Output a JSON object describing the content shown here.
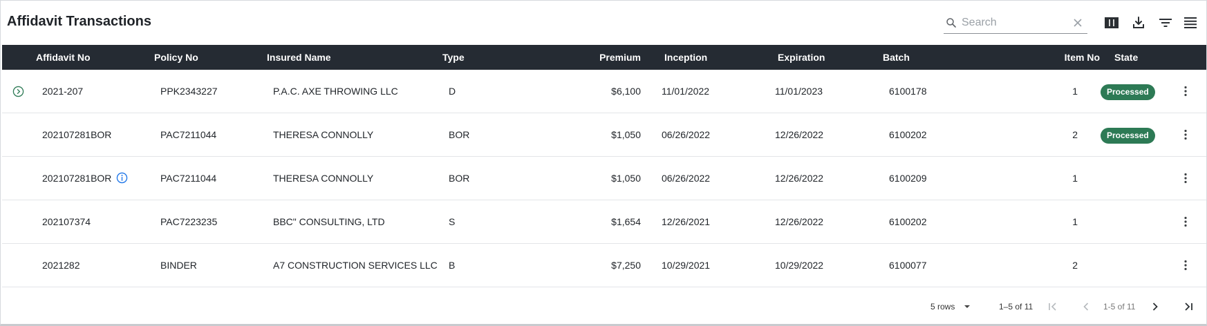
{
  "toolbar": {
    "title": "Affidavit Transactions",
    "search_placeholder": "Search",
    "search_value": ""
  },
  "columns": [
    "Affidavit No",
    "Policy No",
    "Insured Name",
    "Type",
    "Premium",
    "Inception",
    "Expiration",
    "Batch",
    "Item No",
    "State"
  ],
  "rows": [
    {
      "affidavit_no": "2021-207",
      "policy_no": "PPK2343227",
      "insured_name": "P.A.C. AXE THROWING LLC",
      "type": "D",
      "premium": "$6,100",
      "inception": "11/01/2022",
      "expiration": "11/01/2023",
      "batch": "6100178",
      "item_no": "1",
      "state": "Processed"
    },
    {
      "affidavit_no": "202107281BOR",
      "policy_no": "PAC7211044",
      "insured_name": "THERESA CONNOLLY",
      "type": "BOR",
      "premium": "$1,050",
      "inception": "06/26/2022",
      "expiration": "12/26/2022",
      "batch": "6100202",
      "item_no": "2",
      "state": "Processed"
    },
    {
      "affidavit_no": "202107281BOR",
      "policy_no": "PAC7211044",
      "insured_name": "THERESA CONNOLLY",
      "type": "BOR",
      "premium": "$1,050",
      "inception": "06/26/2022",
      "expiration": "12/26/2022",
      "batch": "6100209",
      "item_no": "1",
      "state": ""
    },
    {
      "affidavit_no": "202107374",
      "policy_no": "PAC7223235",
      "insured_name": "BBC\" CONSULTING, LTD",
      "type": "S",
      "premium": "$1,654",
      "inception": "12/26/2021",
      "expiration": "12/26/2022",
      "batch": "6100202",
      "item_no": "1",
      "state": ""
    },
    {
      "affidavit_no": "2021282",
      "policy_no": "BINDER",
      "insured_name": "A7 CONSTRUCTION SERVICES LLC",
      "type": "B",
      "premium": "$7,250",
      "inception": "10/29/2021",
      "expiration": "10/29/2022",
      "batch": "6100077",
      "item_no": "2",
      "state": ""
    }
  ],
  "footer": {
    "rows_per_page": "5 rows",
    "range": "1–5 of 11",
    "page_of": "1-5 of 11"
  },
  "colors": {
    "header_bg": "#252b33",
    "badge_bg": "#2d7a55",
    "expand_icon": "#2d7a55",
    "info_icon": "#1a73e8"
  },
  "icons": {
    "search": "search-icon",
    "clear": "close-icon",
    "columns": "view-column-icon",
    "download": "download-icon",
    "filter": "filter-icon",
    "density": "density-icon",
    "row_expand": "chevron-circle-icon",
    "info": "info-icon",
    "row_menu": "more-vert-icon"
  }
}
